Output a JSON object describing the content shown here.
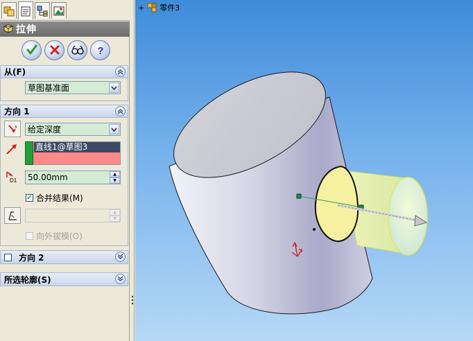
{
  "tabs": [
    {
      "name": "feature-manager",
      "icon": "feature-tree-icon"
    },
    {
      "name": "property-manager",
      "icon": "property-manager-icon"
    },
    {
      "name": "configuration-manager",
      "icon": "configuration-icon"
    },
    {
      "name": "display-manager",
      "icon": "display-manager-icon"
    }
  ],
  "header": {
    "title": "拉伸",
    "icon": "extrude-icon"
  },
  "actions": {
    "ok": "ok-check-icon",
    "cancel": "cancel-x-icon",
    "preview": "detailed-preview-icon",
    "help": "help-icon"
  },
  "from": {
    "label": "从(F)",
    "start_condition": "草图基准面"
  },
  "direction1": {
    "label": "方向 1",
    "end_condition": "给定深度",
    "direction_reference": "直线1@草图3",
    "depth": "50.00mm",
    "depth_label": "D1",
    "merge_result": {
      "label": "合并结果(M)",
      "checked": true
    },
    "draft_angle": "",
    "draft_outward": {
      "label": "向外拔模(O)",
      "checked": false,
      "enabled": false
    }
  },
  "direction2": {
    "label": "方向 2",
    "checked": false
  },
  "selected_contours": {
    "label": "所选轮廓(S)"
  },
  "tree": {
    "part_name": "零件3"
  },
  "colors": {
    "viewport_top": "#3f8bd9",
    "viewport_bottom": "#b6d8f6",
    "panel_bg": "#ece9d8",
    "header_bg": "#777777",
    "combo_bg": "#d4ecd4",
    "selection_pink": "#ff8888",
    "selection_item": "#3c4963",
    "preview_yellow": "#f2f5b8"
  }
}
